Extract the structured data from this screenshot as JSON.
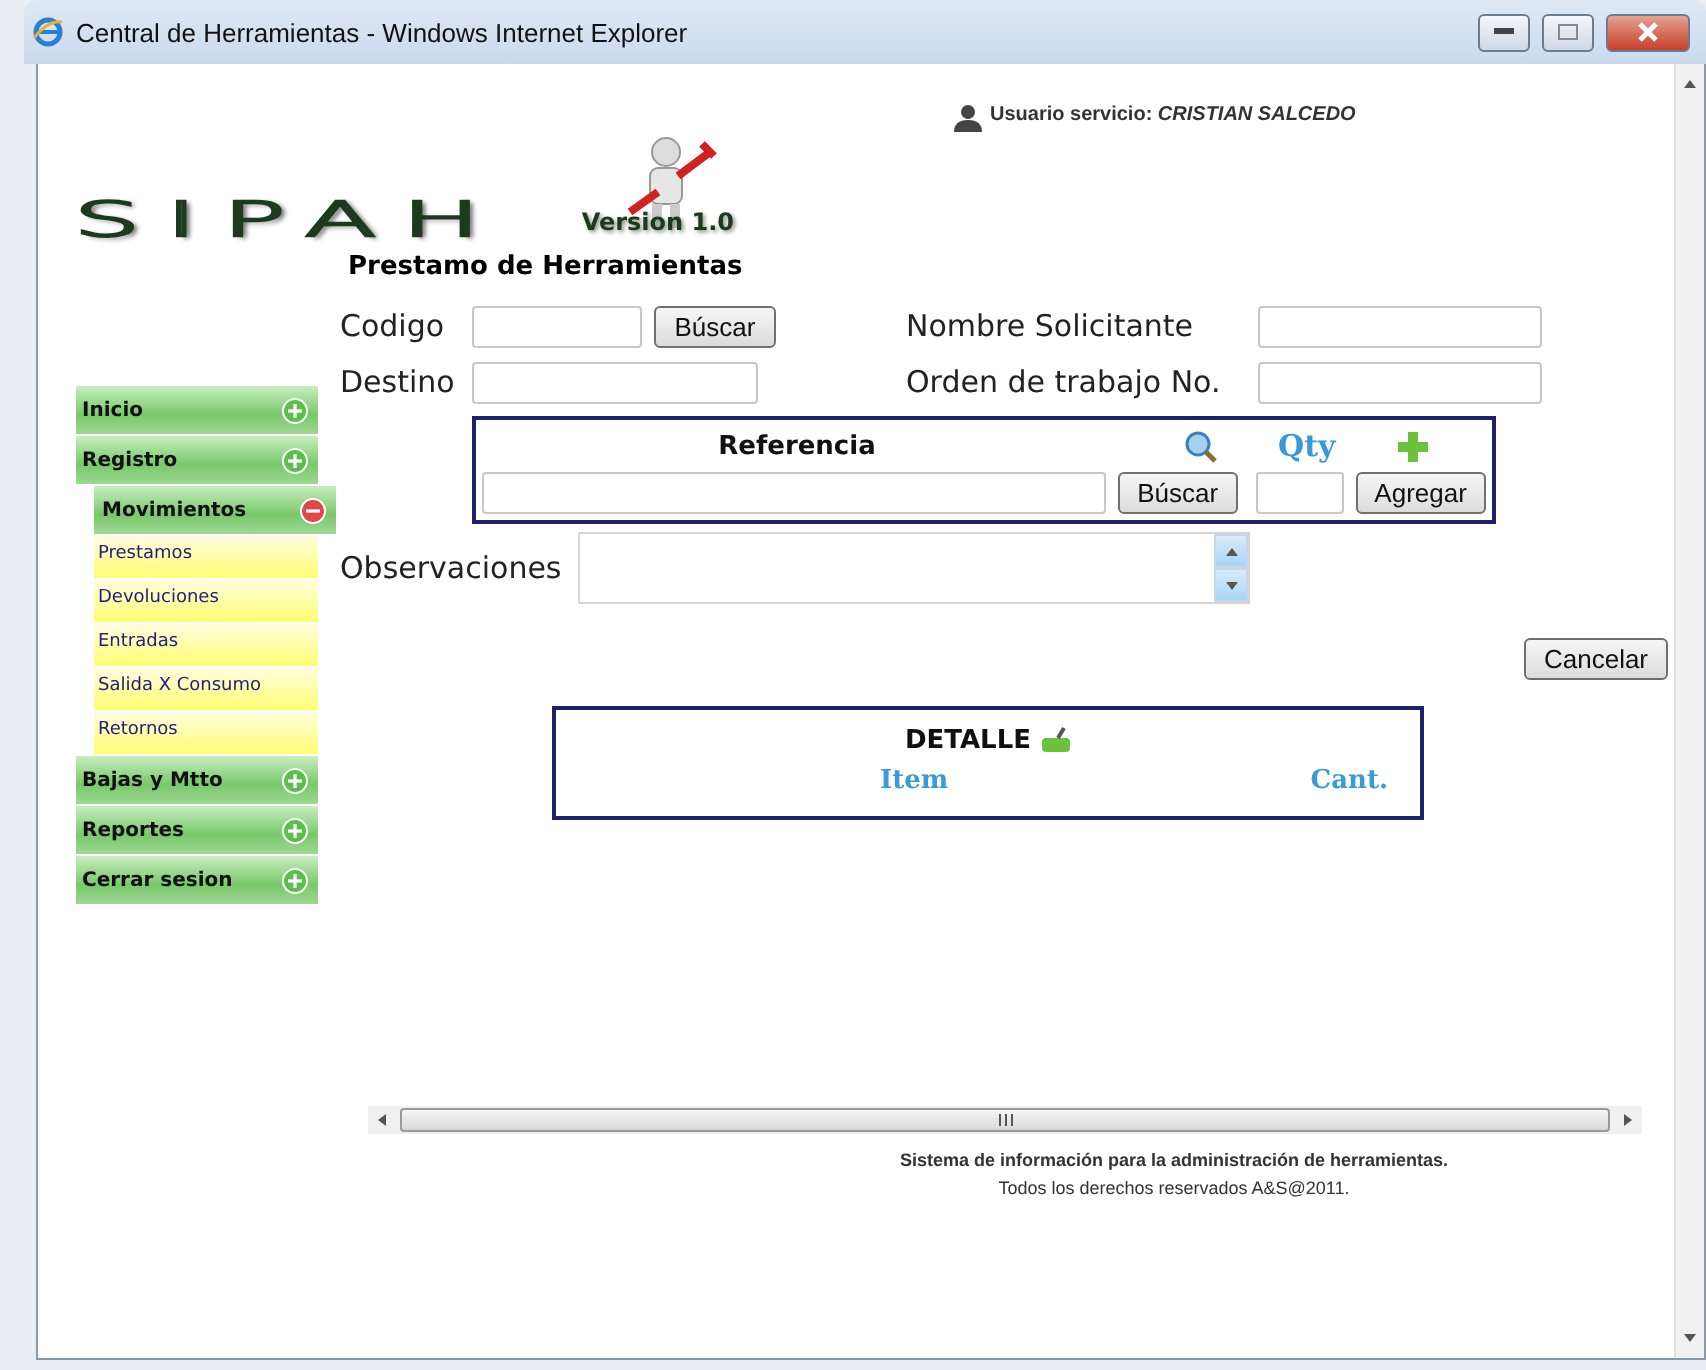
{
  "window": {
    "title": "Central de Herramientas - Windows Internet Explorer"
  },
  "user": {
    "label": "Usuario servicio:",
    "name": "CRISTIAN SALCEDO"
  },
  "logo": {
    "text": "SIPAH",
    "version": "Version 1.0"
  },
  "heading": "Prestamo de Herramientas",
  "menu": [
    {
      "label": "Inicio",
      "expanded": false
    },
    {
      "label": "Registro",
      "expanded": false,
      "children": [
        {
          "label": "Movimientos",
          "expanded": true,
          "children": [
            {
              "label": "Prestamos"
            },
            {
              "label": "Devoluciones"
            },
            {
              "label": "Entradas"
            },
            {
              "label": "Salida X Consumo"
            },
            {
              "label": "Retornos"
            }
          ]
        }
      ]
    },
    {
      "label": "Bajas y Mtto",
      "expanded": false
    },
    {
      "label": "Reportes",
      "expanded": false
    },
    {
      "label": "Cerrar sesion",
      "expanded": false
    }
  ],
  "form": {
    "codigo_label": "Codigo",
    "codigo_button": "Búscar",
    "solicitante_label": "Nombre Solicitante",
    "destino_label": "Destino",
    "orden_label": "Orden de trabajo No.",
    "referencia": {
      "title": "Referencia",
      "qty": "Qty",
      "search_button": "Búscar",
      "add_button": "Agregar"
    },
    "observaciones_label": "Observaciones",
    "cancel_button": "Cancelar"
  },
  "detalle": {
    "title": "DETALLE",
    "columns": [
      "Item",
      "Cant."
    ]
  },
  "footer": {
    "line1": "Sistema de información para la administración de herramientas.",
    "line2": "Todos los derechos reservados A&S@2011."
  }
}
